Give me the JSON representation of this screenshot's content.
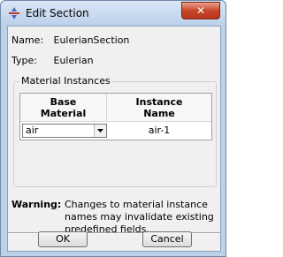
{
  "window": {
    "title": "Edit Section",
    "close_label": "✕"
  },
  "section": {
    "name_label": "Name:",
    "name_value": "EulerianSection",
    "type_label": "Type:",
    "type_value": "Eulerian"
  },
  "material_instances": {
    "group_title": "Material Instances",
    "columns": [
      {
        "label": "Base\nMaterial"
      },
      {
        "label": "Instance\nName"
      }
    ],
    "rows": [
      {
        "base_material": "air",
        "instance_name": "air-1"
      }
    ]
  },
  "warning": {
    "label": "Warning:",
    "text": "Changes to material instance names may invalidate existing predefined fields."
  },
  "buttons": {
    "ok": "OK",
    "cancel": "Cancel"
  },
  "colors": {
    "titlebar": "#bcd0e9",
    "close_button": "#c8462a",
    "client_bg": "#f0f0f0"
  }
}
